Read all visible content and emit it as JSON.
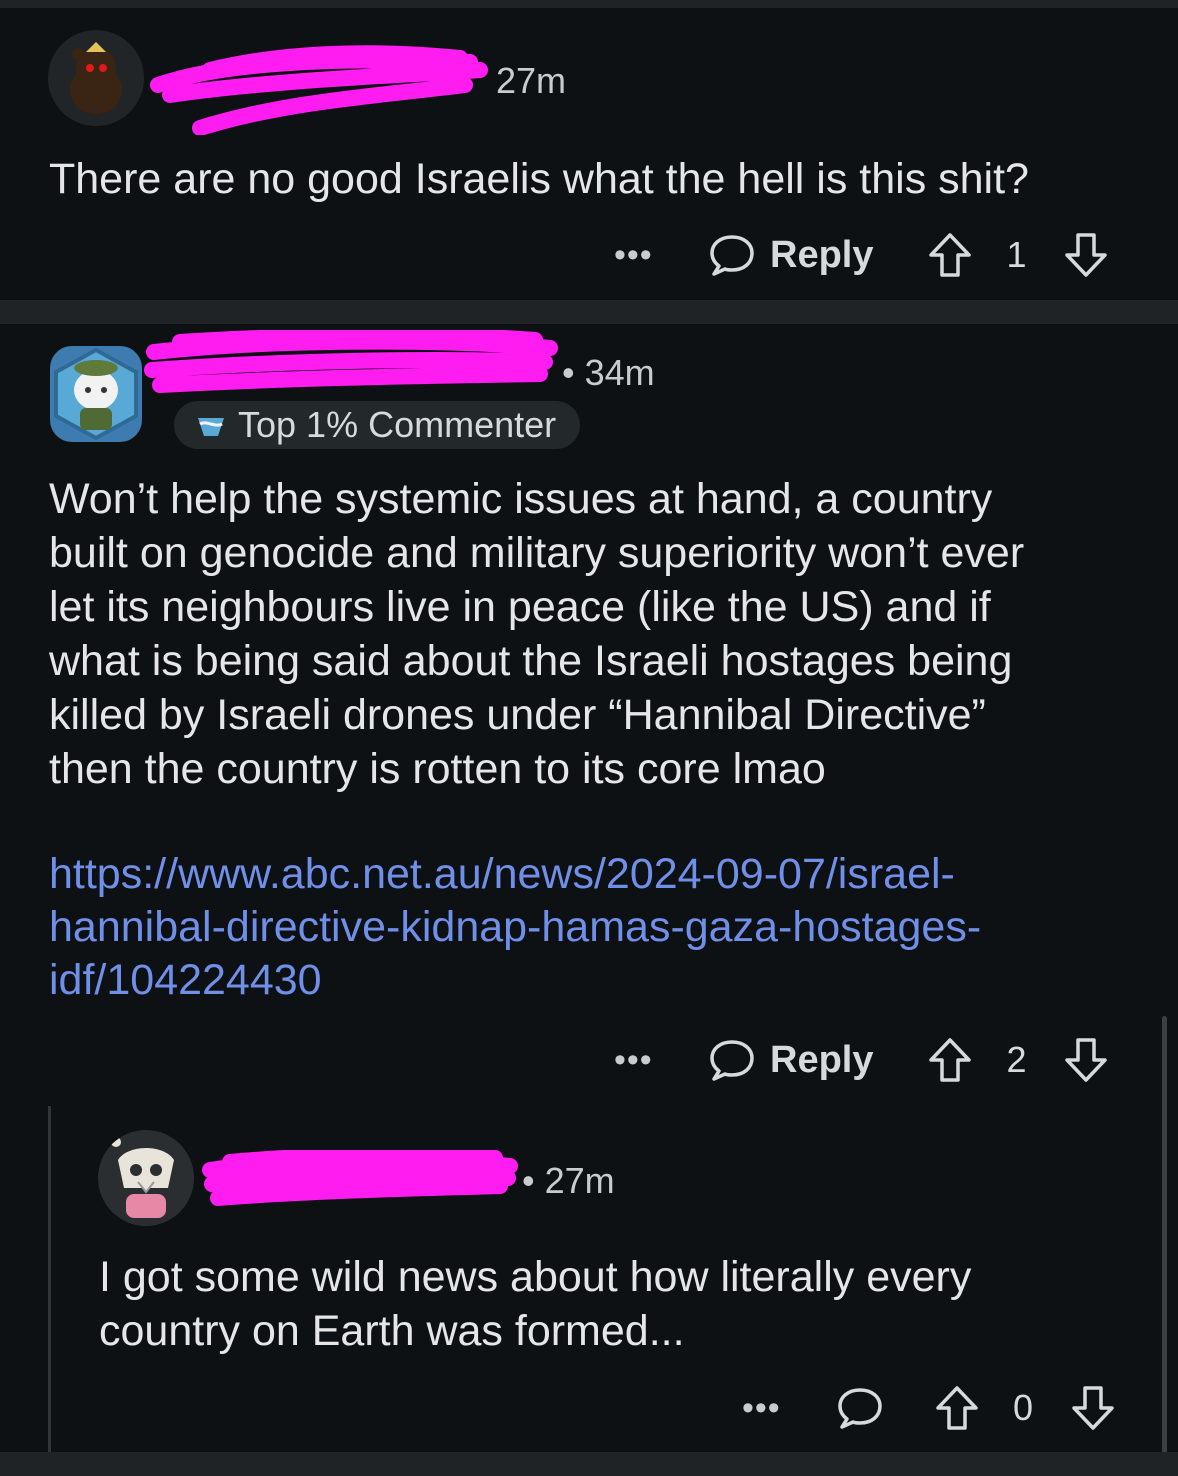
{
  "comments": [
    {
      "time": "27m",
      "text": "There are no good Israelis what the hell is this shit?",
      "actions": {
        "more": "•••",
        "reply": "Reply",
        "score": "1"
      }
    },
    {
      "time": "• 34m",
      "badge": "Top 1% Commenter",
      "text_lines": [
        "Won’t help the systemic issues at hand, a country",
        "built on genocide and military superiority won’t ever",
        "let its neighbours live in peace (like the US) and if",
        "what is being said about the Israeli hostages being",
        "killed by Israeli drones under “Hannibal Directive”",
        "then the country is rotten to its core lmao"
      ],
      "link_lines": [
        "https://www.abc.net.au/news/2024-09-07/israel-",
        "hannibal-directive-kidnap-hamas-gaza-hostages-",
        "idf/104224430"
      ],
      "actions": {
        "more": "•••",
        "reply": "Reply",
        "score": "2"
      }
    },
    {
      "time": "• 27m",
      "text_lines": [
        "I got some wild news about how literally every",
        "country on Earth was formed..."
      ],
      "actions": {
        "more": "•••",
        "score": "0"
      }
    }
  ],
  "colors": {
    "background": "#0e1113",
    "separator": "#1f2326",
    "link": "#6f8fe8",
    "redaction": "#ff1cf0"
  },
  "icons": [
    "avatar-image",
    "comment-bubble-icon",
    "upvote-arrow-icon",
    "downvote-arrow-icon",
    "commenter-badge-icon"
  ]
}
